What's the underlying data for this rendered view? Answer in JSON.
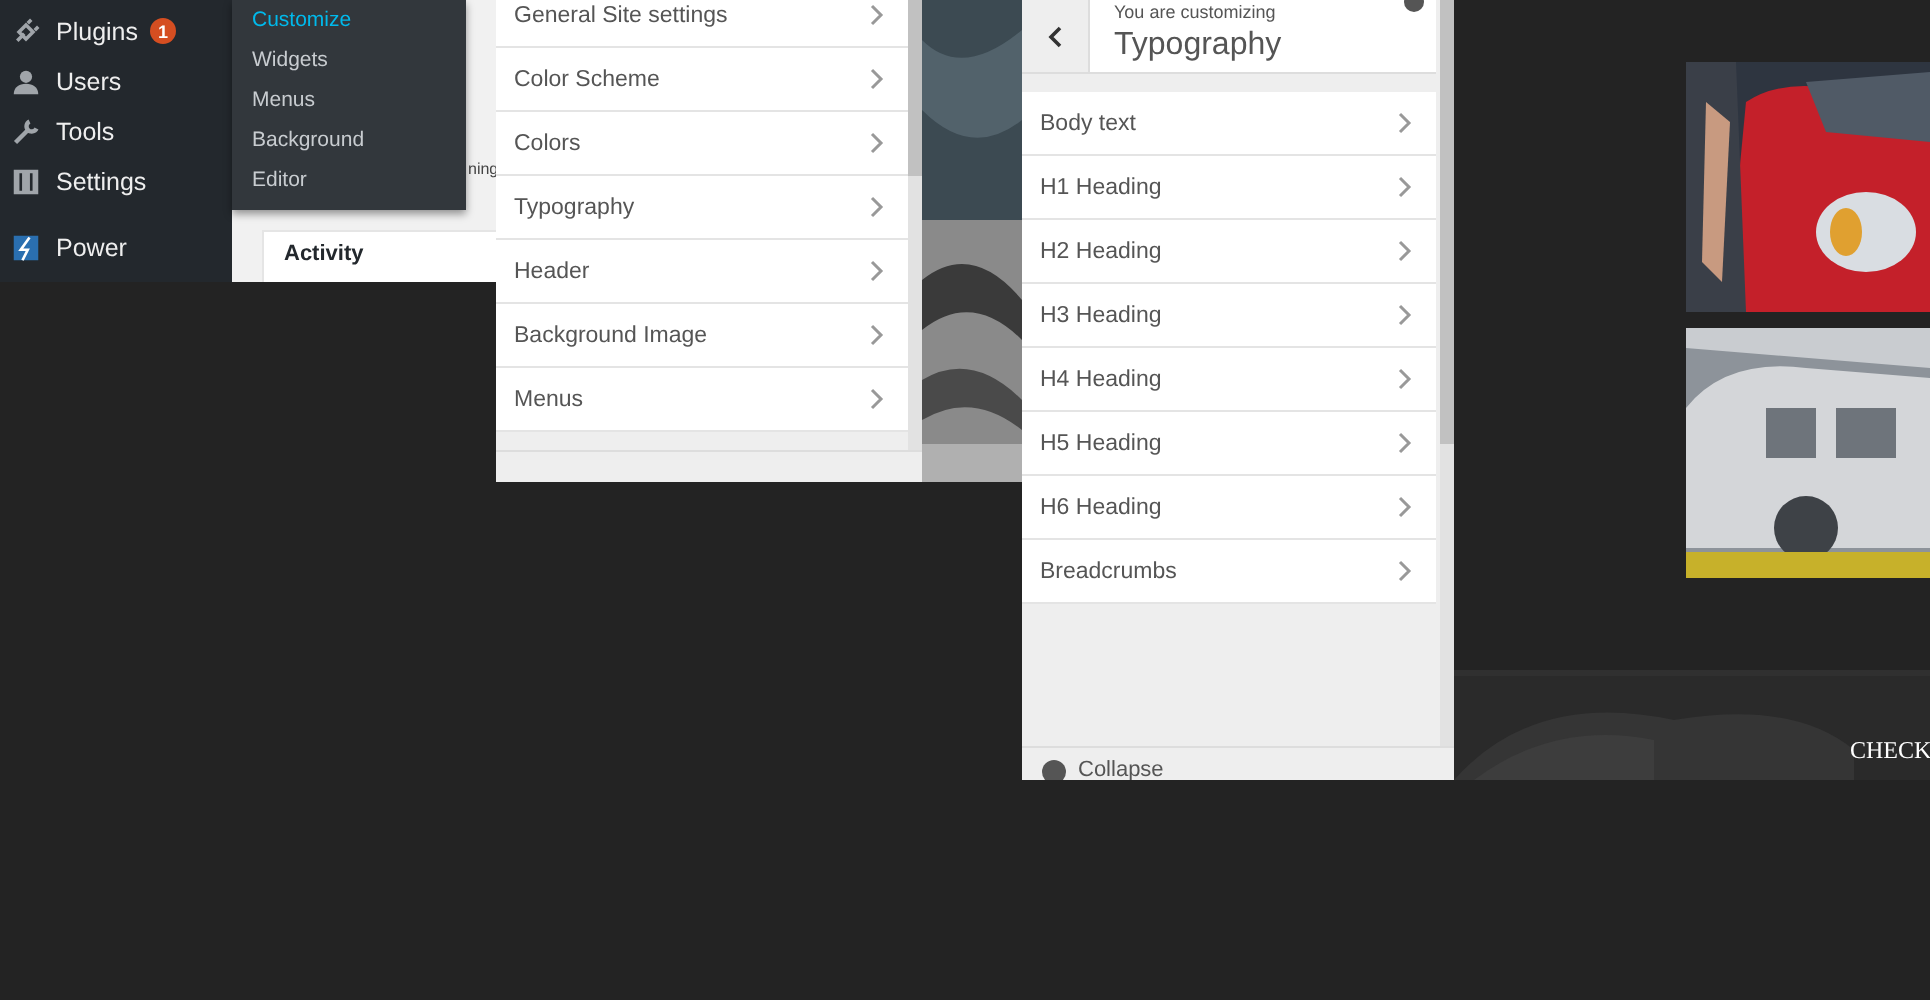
{
  "admin_menu": {
    "items": [
      {
        "label": "Plugins",
        "kind": "plugin",
        "badge": "1"
      },
      {
        "label": "Users",
        "kind": "user"
      },
      {
        "label": "Tools",
        "kind": "tool"
      },
      {
        "label": "Settings",
        "kind": "settings"
      },
      {
        "label": "Power",
        "kind": "power"
      }
    ],
    "submenu": [
      {
        "label": "Customize",
        "selected": true
      },
      {
        "label": "Widgets",
        "selected": false
      },
      {
        "label": "Menus",
        "selected": false
      },
      {
        "label": "Background",
        "selected": false
      },
      {
        "label": "Editor",
        "selected": false
      }
    ],
    "content": {
      "fragment": "ning",
      "widget_title": "Activity"
    }
  },
  "customizer_main": {
    "sections": [
      "General Site settings",
      "Color Scheme",
      "Colors",
      "Typography",
      "Header",
      "Background Image",
      "Menus"
    ]
  },
  "customizer_typography": {
    "eyebrow": "You are customizing",
    "title": "Typography",
    "sections": [
      "Body text",
      "H1 Heading",
      "H2 Heading",
      "H3 Heading",
      "H4 Heading",
      "H5 Heading",
      "H6 Heading",
      "Breadcrumbs"
    ],
    "footer": "Collapse"
  },
  "site": {
    "banner_text": "CHECK"
  }
}
